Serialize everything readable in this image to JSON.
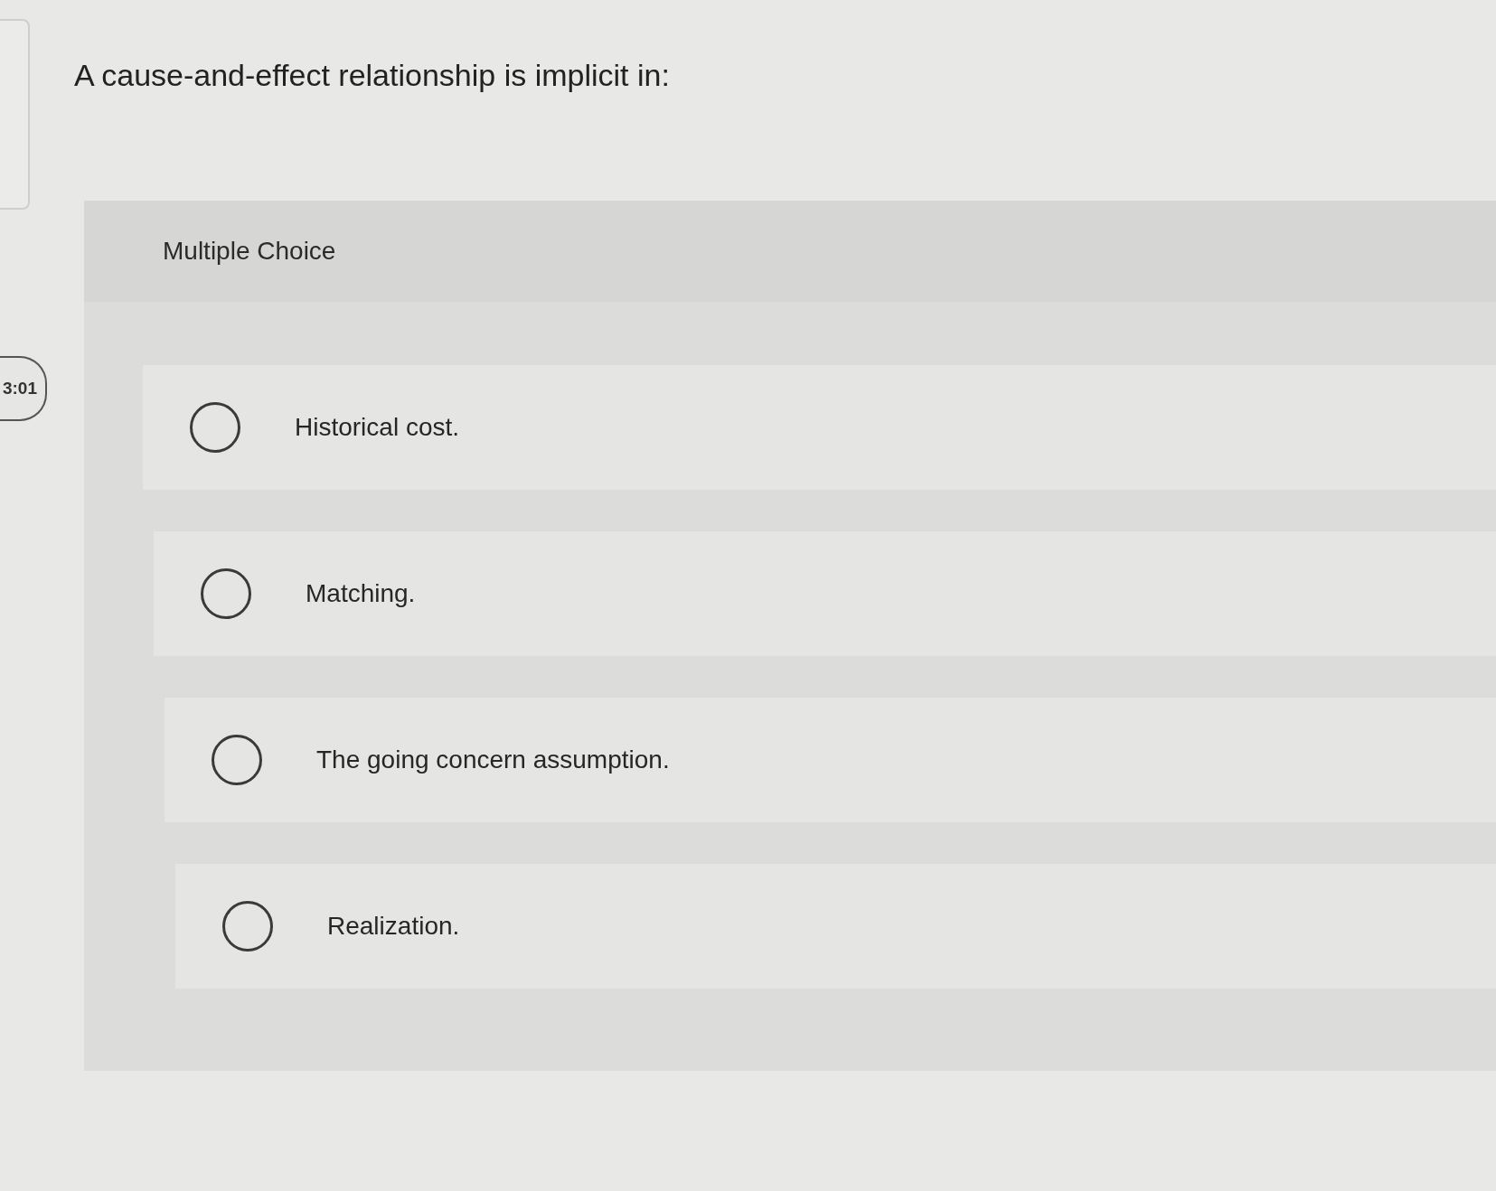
{
  "timer": {
    "text": "3:01"
  },
  "question": "A cause-and-effect relationship is implicit in:",
  "answer_panel": {
    "type_label": "Multiple Choice",
    "options": [
      {
        "label": "Historical cost.",
        "selected": false
      },
      {
        "label": "Matching.",
        "selected": false
      },
      {
        "label": "The going concern assumption.",
        "selected": false
      },
      {
        "label": "Realization.",
        "selected": false
      }
    ]
  }
}
